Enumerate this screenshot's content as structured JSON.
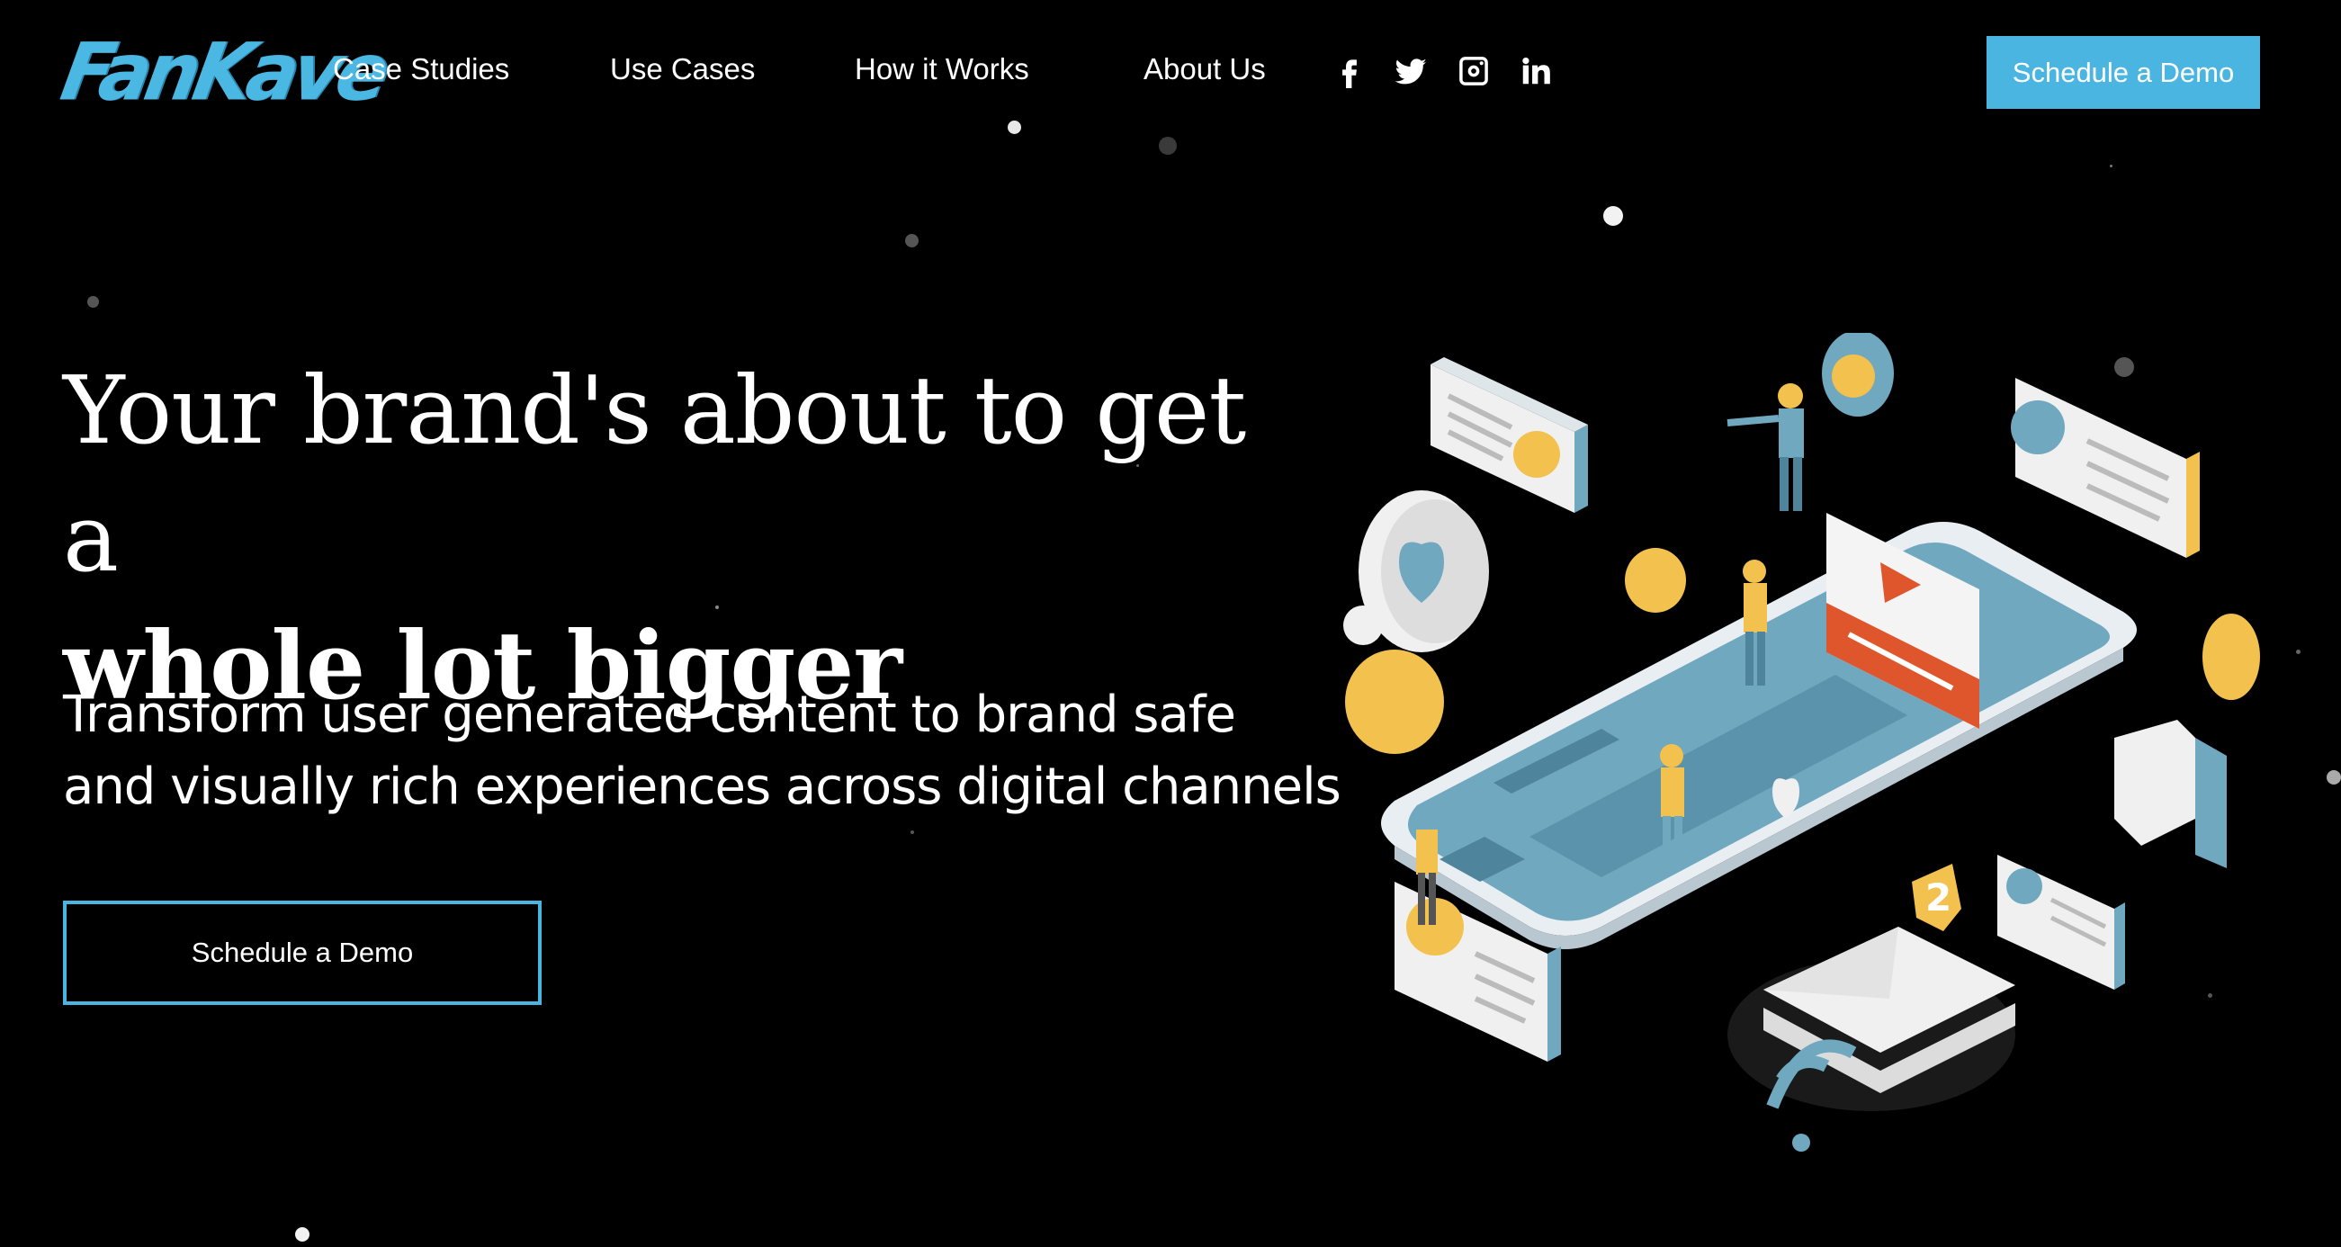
{
  "brand": {
    "logo_text": "FanKave",
    "accent_color": "#4bb5e2"
  },
  "nav": {
    "links": [
      "Case Studies",
      "Use Cases",
      "How it Works",
      "About Us"
    ],
    "social_icons": [
      "facebook-icon",
      "twitter-icon",
      "instagram-icon",
      "linkedin-icon"
    ],
    "cta_label": "Schedule a Demo"
  },
  "hero": {
    "headline_line1": "Your brand's about to get a",
    "headline_line2": "whole lot bigger",
    "subtext": "Transform user generated content to brand safe and visually rich experiences across digital channels",
    "cta_label": "Schedule a Demo"
  },
  "illustration": {
    "description_icon": "social-media-phone-illustration",
    "colors": {
      "blue": "#6fa8bf",
      "yellow": "#f2c14e",
      "orange": "#e0562c",
      "white": "#f0f0f0"
    },
    "badge_number": "2"
  }
}
